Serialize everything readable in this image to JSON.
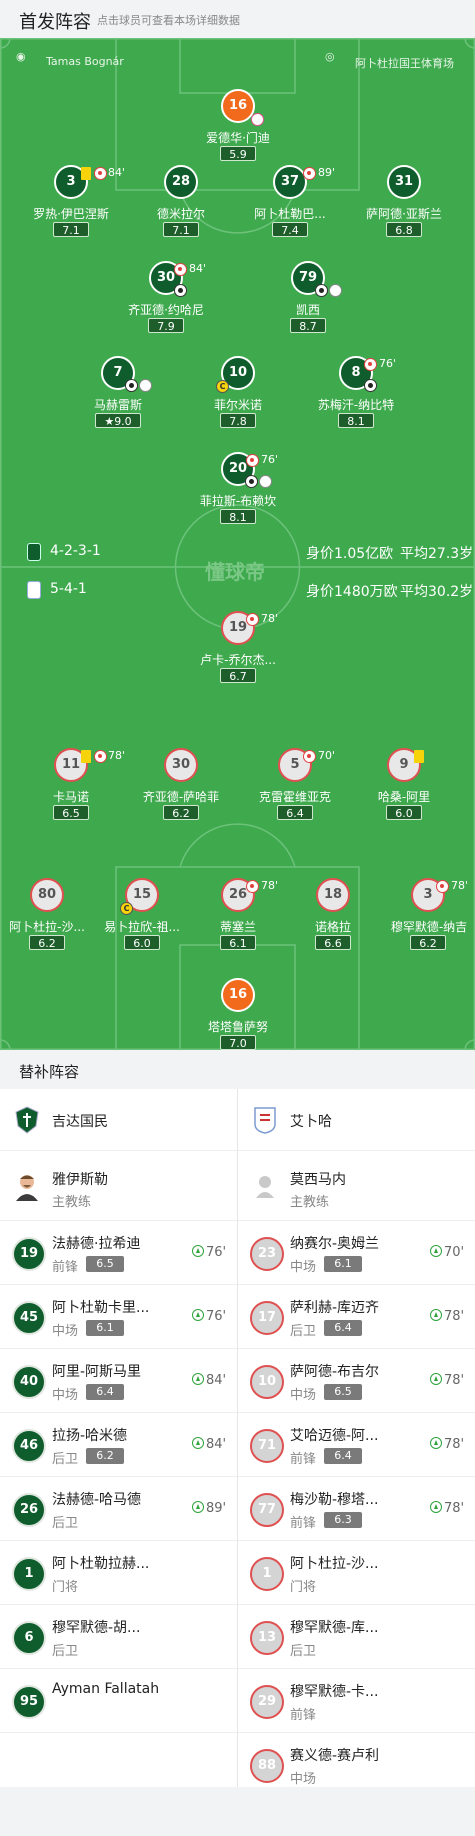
{
  "header": {
    "title": "首发阵容",
    "subtitle": "点击球员可查看本场详细数据"
  },
  "match": {
    "referee": "Tamas Bognár",
    "venue": "阿卜杜拉国王体育场",
    "watermark": "懂球帝"
  },
  "home": {
    "formation": "4-2-3-1",
    "value": "身价1.05亿欧",
    "age": "平均27.3岁",
    "color": "#0f5d2c"
  },
  "away": {
    "formation": "5-4-1",
    "value": "身价1480万欧",
    "age": "平均30.2岁",
    "color": "#e05050"
  },
  "lineup_home": [
    {
      "num": "16",
      "name": "爱德华·门迪",
      "rating": "5.9",
      "role": "gk"
    },
    {
      "num": "3",
      "name": "罗热·伊巴涅斯",
      "rating": "7.1",
      "sub": "84'"
    },
    {
      "num": "28",
      "name": "德米拉尔",
      "rating": "7.1"
    },
    {
      "num": "37",
      "name": "阿卜杜勒巴...",
      "rating": "7.4",
      "sub": "89'"
    },
    {
      "num": "31",
      "name": "萨阿德·亚斯兰",
      "rating": "6.8"
    },
    {
      "num": "30",
      "name": "齐亚德·约哈尼",
      "rating": "7.9",
      "sub": "84'"
    },
    {
      "num": "79",
      "name": "凯西",
      "rating": "8.7"
    },
    {
      "num": "7",
      "name": "马赫雷斯",
      "rating": "9.0"
    },
    {
      "num": "10",
      "name": "菲尔米诺",
      "rating": "7.8"
    },
    {
      "num": "8",
      "name": "苏梅汗-纳比特",
      "rating": "8.1",
      "sub": "76'"
    },
    {
      "num": "20",
      "name": "菲拉斯-布赖坎",
      "rating": "8.1",
      "sub": "76'"
    }
  ],
  "lineup_away": [
    {
      "num": "19",
      "name": "卢卡-乔尔杰...",
      "rating": "6.7",
      "sub": "78'"
    },
    {
      "num": "11",
      "name": "卡马诺",
      "rating": "6.5",
      "sub": "78'"
    },
    {
      "num": "30",
      "name": "齐亚德-萨哈菲",
      "rating": "6.2"
    },
    {
      "num": "5",
      "name": "克雷霍维亚克",
      "rating": "6.4",
      "sub": "70'"
    },
    {
      "num": "9",
      "name": "哈桑-阿里",
      "rating": "6.0"
    },
    {
      "num": "80",
      "name": "阿卜杜拉-沙...",
      "rating": "6.2"
    },
    {
      "num": "15",
      "name": "易卜拉欣-祖...",
      "rating": "6.0"
    },
    {
      "num": "26",
      "name": "蒂塞兰",
      "rating": "6.1",
      "sub": "78'"
    },
    {
      "num": "18",
      "name": "诺格拉",
      "rating": "6.6"
    },
    {
      "num": "3",
      "name": "穆罕默德-纳吉",
      "rating": "6.2",
      "sub": "78'"
    },
    {
      "num": "16",
      "name": "塔塔鲁萨努",
      "rating": "7.0",
      "role": "gk"
    }
  ],
  "subs": {
    "title": "替补阵容",
    "home": {
      "team": "吉达国民",
      "coach": "雅伊斯勒",
      "coach_role": "主教练",
      "players": [
        {
          "num": "19",
          "name": "法赫德·拉希迪",
          "pos": "前锋",
          "rating": "6.5",
          "min": "76'"
        },
        {
          "num": "45",
          "name": "阿卜杜勒卡里...",
          "pos": "中场",
          "rating": "6.1",
          "min": "76'"
        },
        {
          "num": "40",
          "name": "阿里-阿斯马里",
          "pos": "中场",
          "rating": "6.4",
          "min": "84'"
        },
        {
          "num": "46",
          "name": "拉扬-哈米德",
          "pos": "后卫",
          "rating": "6.2",
          "min": "84'"
        },
        {
          "num": "26",
          "name": "法赫德-哈马德",
          "pos": "后卫",
          "rating": "",
          "min": "89'"
        },
        {
          "num": "1",
          "name": "阿卜杜勒拉赫...",
          "pos": "门将",
          "rating": "",
          "min": ""
        },
        {
          "num": "6",
          "name": "穆罕默德-胡...",
          "pos": "后卫",
          "rating": "",
          "min": ""
        },
        {
          "num": "95",
          "name": "Ayman Fallatah",
          "pos": "",
          "rating": "",
          "min": ""
        }
      ]
    },
    "away": {
      "team": "艾卜哈",
      "coach": "莫西马内",
      "coach_role": "主教练",
      "players": [
        {
          "num": "23",
          "name": "纳赛尔-奥姆兰",
          "pos": "中场",
          "rating": "6.1",
          "min": "70'"
        },
        {
          "num": "17",
          "name": "萨利赫-库迈齐",
          "pos": "后卫",
          "rating": "6.4",
          "min": "78'"
        },
        {
          "num": "10",
          "name": "萨阿德-布吉尔",
          "pos": "中场",
          "rating": "6.5",
          "min": "78'"
        },
        {
          "num": "71",
          "name": "艾哈迈德-阿...",
          "pos": "前锋",
          "rating": "6.4",
          "min": "78'"
        },
        {
          "num": "77",
          "name": "梅沙勒-穆塔...",
          "pos": "前锋",
          "rating": "6.3",
          "min": "78'"
        },
        {
          "num": "1",
          "name": "阿卜杜拉-沙...",
          "pos": "门将",
          "rating": "",
          "min": ""
        },
        {
          "num": "13",
          "name": "穆罕默德-库...",
          "pos": "后卫",
          "rating": "",
          "min": ""
        },
        {
          "num": "29",
          "name": "穆罕默德-卡...",
          "pos": "前锋",
          "rating": "",
          "min": ""
        },
        {
          "num": "88",
          "name": "赛义德-赛卢利",
          "pos": "中场",
          "rating": "",
          "min": ""
        }
      ]
    }
  }
}
